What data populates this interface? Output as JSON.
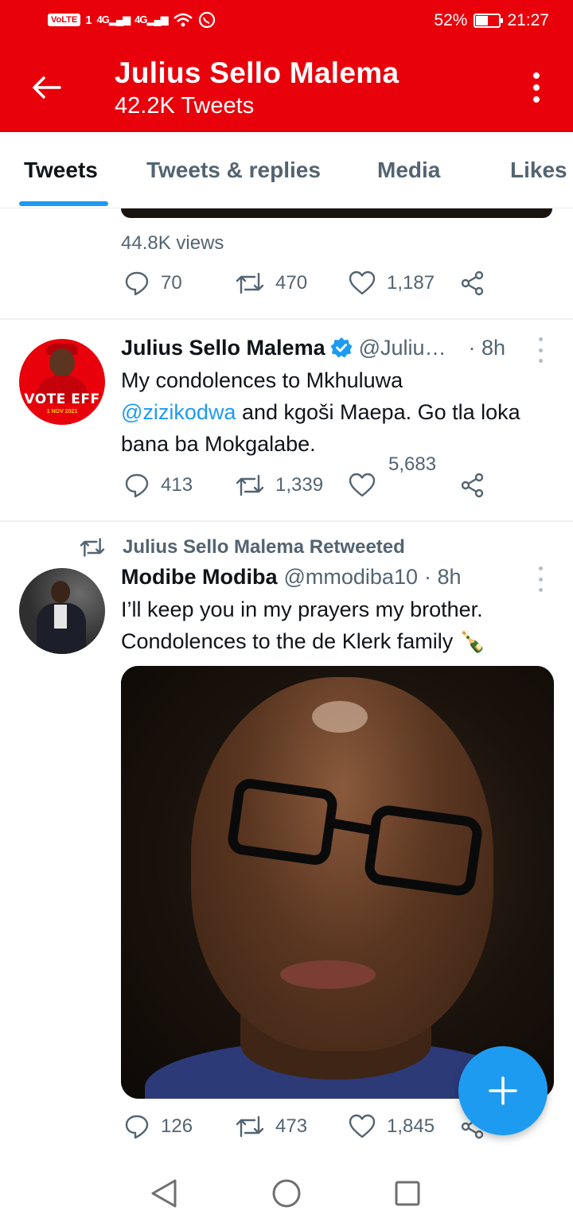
{
  "status_bar": {
    "volte": "VoLTE",
    "sim1": "1",
    "net1": "4G",
    "net2": "4G",
    "battery": "52%",
    "battery_level": 0.52,
    "time": "21:27"
  },
  "header": {
    "name": "Julius Sello Malema",
    "tweet_count": "42.2K Tweets"
  },
  "tabs": [
    {
      "label": "Tweets",
      "active": true
    },
    {
      "label": "Tweets & replies",
      "active": false
    },
    {
      "label": "Media",
      "active": false
    },
    {
      "label": "Likes",
      "active": false
    }
  ],
  "tweets": [
    {
      "views": "44.8K views",
      "replies": "70",
      "retweets": "470",
      "likes": "1,187"
    },
    {
      "name": "Julius Sello Malema",
      "handle": "@Juliu…",
      "time": "· 8h",
      "avatar_vote": "VOTE EFF",
      "avatar_date": "1 NOV 2021",
      "text_1": "My condolences to Mkhuluwa",
      "mention": "@zizikodwa",
      "text_2": " and kgoši Maepa. Go tla loka bana ba Mokgalabe.",
      "replies": "413",
      "retweets": "1,339",
      "likes": "5,683"
    },
    {
      "retweeted_by": "Julius Sello Malema Retweeted",
      "name": "Modibe Modiba",
      "handle": "@mmodiba10",
      "time": "· 8h",
      "text": "I’ll keep you in my prayers my brother. Condolences to the de Klerk family 🍾",
      "replies": "126",
      "retweets": "473",
      "likes": "1,845"
    }
  ],
  "colors": {
    "header_red": "#e8000b",
    "accent_blue": "#1d9bf0",
    "muted": "#536471"
  },
  "icons": [
    "back-arrow-icon",
    "more-vertical-icon",
    "reply-icon",
    "retweet-icon",
    "like-icon",
    "share-icon",
    "verified-icon",
    "plus-icon",
    "nav-back-icon",
    "nav-home-icon",
    "nav-recents-icon"
  ]
}
